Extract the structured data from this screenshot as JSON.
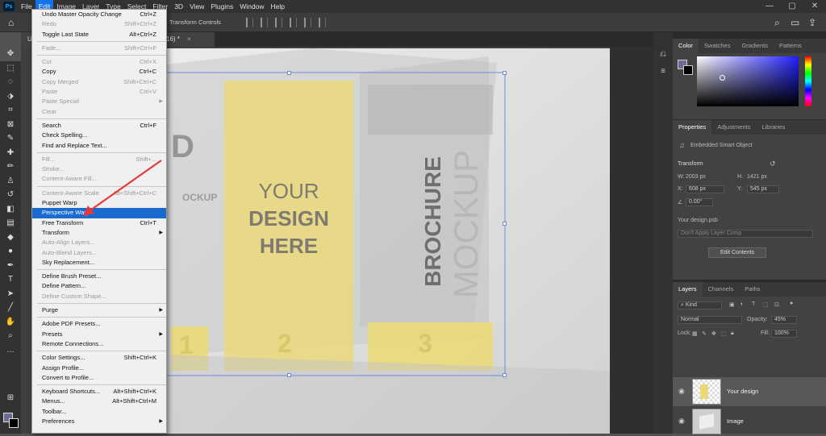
{
  "menubar": {
    "logo": "Ps",
    "items": [
      "File",
      "Edit",
      "Image",
      "Layer",
      "Type",
      "Select",
      "Filter",
      "3D",
      "View",
      "Plugins",
      "Window",
      "Help"
    ],
    "active_index": 1,
    "window_controls": [
      "—",
      "▢",
      "✕"
    ]
  },
  "options_bar": {
    "transform_controls_label": "Transform Controls"
  },
  "document_tab": {
    "label": "U",
    "suffix": "16) *"
  },
  "artwork": {
    "left_letter": "D",
    "left_mockup_text": "OCKUP",
    "your": "YOUR",
    "design": "DESIGN",
    "here": "HERE",
    "brochure": "BROCHURE",
    "mockup": "MOCKUP",
    "num1": "1",
    "num2": "2",
    "num3": "3"
  },
  "edit_menu": {
    "items": [
      {
        "label": "Undo Master Opacity Change",
        "shortcut": "Ctrl+Z",
        "disabled": false
      },
      {
        "label": "Redo",
        "shortcut": "Shift+Ctrl+Z",
        "disabled": true
      },
      {
        "label": "Toggle Last State",
        "shortcut": "Alt+Ctrl+Z",
        "disabled": false
      },
      {
        "sep": true
      },
      {
        "label": "Fade...",
        "shortcut": "Shift+Ctrl+F",
        "disabled": true
      },
      {
        "sep": true
      },
      {
        "label": "Cut",
        "shortcut": "Ctrl+X",
        "disabled": true
      },
      {
        "label": "Copy",
        "shortcut": "Ctrl+C",
        "disabled": false
      },
      {
        "label": "Copy Merged",
        "shortcut": "Shift+Ctrl+C",
        "disabled": true
      },
      {
        "label": "Paste",
        "shortcut": "Ctrl+V",
        "disabled": true
      },
      {
        "label": "Paste Special",
        "shortcut": "",
        "disabled": true,
        "submenu": true
      },
      {
        "label": "Clear",
        "shortcut": "",
        "disabled": true
      },
      {
        "sep": true
      },
      {
        "label": "Search",
        "shortcut": "Ctrl+F",
        "disabled": false
      },
      {
        "label": "Check Spelling...",
        "shortcut": "",
        "disabled": false
      },
      {
        "label": "Find and Replace Text...",
        "shortcut": "",
        "disabled": false
      },
      {
        "sep": true
      },
      {
        "label": "Fill...",
        "shortcut": "Shift+...",
        "disabled": true
      },
      {
        "label": "Stroke...",
        "shortcut": "",
        "disabled": true
      },
      {
        "label": "Content-Aware Fill...",
        "shortcut": "",
        "disabled": true
      },
      {
        "sep": true
      },
      {
        "label": "Content-Aware Scale",
        "shortcut": "Alt+Shift+Ctrl+C",
        "disabled": true
      },
      {
        "label": "Puppet Warp",
        "shortcut": "",
        "disabled": false
      },
      {
        "label": "Perspective Warp",
        "shortcut": "",
        "disabled": false,
        "highlight": true
      },
      {
        "label": "Free Transform",
        "shortcut": "Ctrl+T",
        "disabled": false
      },
      {
        "label": "Transform",
        "shortcut": "",
        "disabled": false,
        "submenu": true
      },
      {
        "label": "Auto-Align Layers...",
        "shortcut": "",
        "disabled": true
      },
      {
        "label": "Auto-Blend Layers...",
        "shortcut": "",
        "disabled": true
      },
      {
        "label": "Sky Replacement...",
        "shortcut": "",
        "disabled": false
      },
      {
        "sep": true
      },
      {
        "label": "Define Brush Preset...",
        "shortcut": "",
        "disabled": false
      },
      {
        "label": "Define Pattern...",
        "shortcut": "",
        "disabled": false
      },
      {
        "label": "Define Custom Shape...",
        "shortcut": "",
        "disabled": true
      },
      {
        "sep": true
      },
      {
        "label": "Purge",
        "shortcut": "",
        "disabled": false,
        "submenu": true
      },
      {
        "sep": true
      },
      {
        "label": "Adobe PDF Presets...",
        "shortcut": "",
        "disabled": false
      },
      {
        "label": "Presets",
        "shortcut": "",
        "disabled": false,
        "submenu": true
      },
      {
        "label": "Remote Connections...",
        "shortcut": "",
        "disabled": false
      },
      {
        "sep": true
      },
      {
        "label": "Color Settings...",
        "shortcut": "Shift+Ctrl+K",
        "disabled": false
      },
      {
        "label": "Assign Profile...",
        "shortcut": "",
        "disabled": false
      },
      {
        "label": "Convert to Profile...",
        "shortcut": "",
        "disabled": false
      },
      {
        "sep": true
      },
      {
        "label": "Keyboard Shortcuts...",
        "shortcut": "Alt+Shift+Ctrl+K",
        "disabled": false
      },
      {
        "label": "Menus...",
        "shortcut": "Alt+Shift+Ctrl+M",
        "disabled": false
      },
      {
        "label": "Toolbar...",
        "shortcut": "",
        "disabled": false
      },
      {
        "label": "Preferences",
        "shortcut": "",
        "disabled": false,
        "submenu": true
      }
    ]
  },
  "color_panel": {
    "tabs": [
      "Color",
      "Swatches",
      "Gradients",
      "Patterns"
    ],
    "fg_color": "#6b6b95"
  },
  "properties_panel": {
    "tabs": [
      "Properties",
      "Adjustments",
      "Libraries"
    ],
    "type": "Embedded Smart Object",
    "section": "Transform",
    "w_label": "W:",
    "w_value": "2003 px",
    "h_label": "H:",
    "h_value": "1421 px",
    "x_label": "X:",
    "x_value": "608 px",
    "y_label": "Y:",
    "y_value": "545 px",
    "angle": "0.00°",
    "filename": "Your design.psb",
    "comp": "Don't Apply Layer Comp",
    "edit_button": "Edit Contents"
  },
  "layers_panel": {
    "tabs": [
      "Layers",
      "Channels",
      "Paths"
    ],
    "filter": "Kind",
    "blend_mode": "Normal",
    "opacity_label": "Opacity:",
    "opacity_value": "45%",
    "lock_label": "Lock:",
    "fill_label": "Fill:",
    "fill_value": "100%",
    "layers": [
      {
        "name": "Your design",
        "selected": true
      },
      {
        "name": "Image",
        "selected": false
      }
    ]
  }
}
